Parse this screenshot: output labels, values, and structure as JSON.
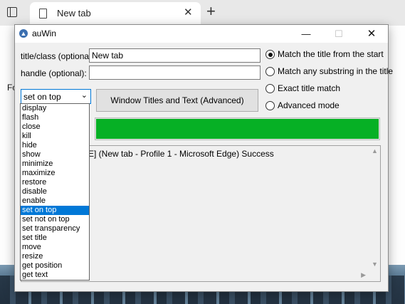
{
  "browser": {
    "tab_title": "New tab",
    "tab_close": "✕",
    "new_tab": "+",
    "toolbar_text": "Fo"
  },
  "window": {
    "title": "auWin",
    "minimize": "—",
    "maximize": "☐",
    "close": "✕"
  },
  "form": {
    "title_label": "title/class (optional):",
    "title_value": "New tab",
    "handle_label": "handle (optional):",
    "handle_value": ""
  },
  "radios": [
    {
      "label": "Match the title from the start",
      "checked": true
    },
    {
      "label": "Match any substring in the title",
      "checked": false
    },
    {
      "label": "Exact title match",
      "checked": false
    },
    {
      "label": "Advanced mode",
      "checked": false
    }
  ],
  "action_select": {
    "value": "set on top",
    "options": [
      "display",
      "flash",
      "close",
      "kill",
      "hide",
      "show",
      "minimize",
      "maximize",
      "restore",
      "disable",
      "enable",
      "set on top",
      "set not on top",
      "set transparency",
      "set title",
      "move",
      "resize",
      "get position",
      "get text"
    ],
    "selected_index": 11
  },
  "advanced_button": "Window Titles and Text (Advanced)",
  "progress": {
    "fraction": 1.0,
    "color": "#06b025"
  },
  "log": {
    "text": "1FE] (New tab - Profile 1 - Microsoft Edge) Success"
  }
}
